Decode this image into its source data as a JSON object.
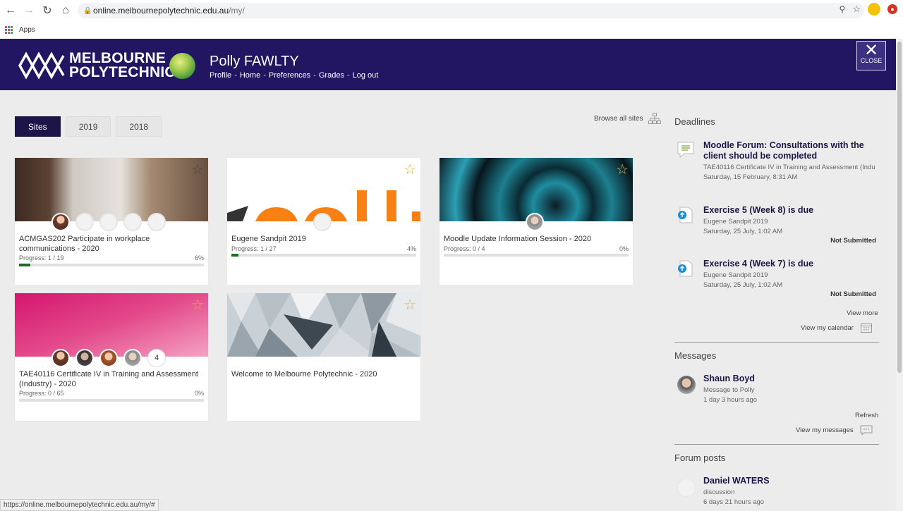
{
  "browser": {
    "url_host": "online.melbournepolytechnic.edu.au",
    "url_path": "/my/",
    "bookmark_apps": "Apps",
    "status_url": "https://online.melbournepolytechnic.edu.au/my/#"
  },
  "header": {
    "logo_line1": "MELBOURNE",
    "logo_line2": "POLYTECHNIC",
    "user_name": "Polly FAWLTY",
    "links": [
      "Profile",
      "Home",
      "Preferences",
      "Grades",
      "Log out"
    ],
    "close_label": "CLOSE",
    "brand_color": "#221662"
  },
  "tabs": [
    "Sites",
    "2019",
    "2018"
  ],
  "browse_all": "Browse all sites",
  "cards": [
    {
      "title": "ACMGAS202 Participate in workplace communications - 2020",
      "progress_label": "Progress: 1 / 19",
      "progress_pct": "6%",
      "progress": 0.06
    },
    {
      "title": "Eugene Sandpit 2019",
      "progress_label": "Progress: 1 / 27",
      "progress_pct": "4%",
      "progress": 0.04
    },
    {
      "title": "Moodle Update Information Session - 2020",
      "progress_label": "Progress: 0 / 4",
      "progress_pct": "0%",
      "progress": 0
    },
    {
      "title": "TAE40116 Certificate IV in Training and Assessment (Industry) - 2020",
      "progress_label": "Progress: 0 / 65",
      "progress_pct": "0%",
      "progress": 0,
      "extra_count": "4"
    },
    {
      "title": "Welcome to Melbourne Polytechnic - 2020"
    }
  ],
  "deadlines": {
    "title": "Deadlines",
    "items": [
      {
        "title": "Moodle Forum: Consultations with the client should be completed",
        "course": "TAE40116 Certificate IV in Training and Assessment (Indu",
        "date": "Saturday, 15 February, 8:31 AM",
        "status": ""
      },
      {
        "title": "Exercise 5 (Week 8) is due",
        "course": "Eugene Sandpit 2019",
        "date": "Saturday, 25 July, 1:02 AM",
        "status": "Not Submitted"
      },
      {
        "title": "Exercise 4 (Week 7) is due",
        "course": "Eugene Sandpit 2019",
        "date": "Saturday, 25 July, 1:02 AM",
        "status": "Not Submitted"
      }
    ],
    "view_more": "View more",
    "view_calendar": "View my calendar"
  },
  "messages": {
    "title": "Messages",
    "sender": "Shaun Boyd",
    "subtitle": "Message to Polly",
    "time": "1 day 3 hours ago",
    "refresh": "Refresh",
    "view_messages": "View my messages"
  },
  "forum": {
    "title": "Forum posts",
    "author": "Daniel WATERS",
    "subtitle": "discussion",
    "time": "6 days 21 hours ago"
  }
}
